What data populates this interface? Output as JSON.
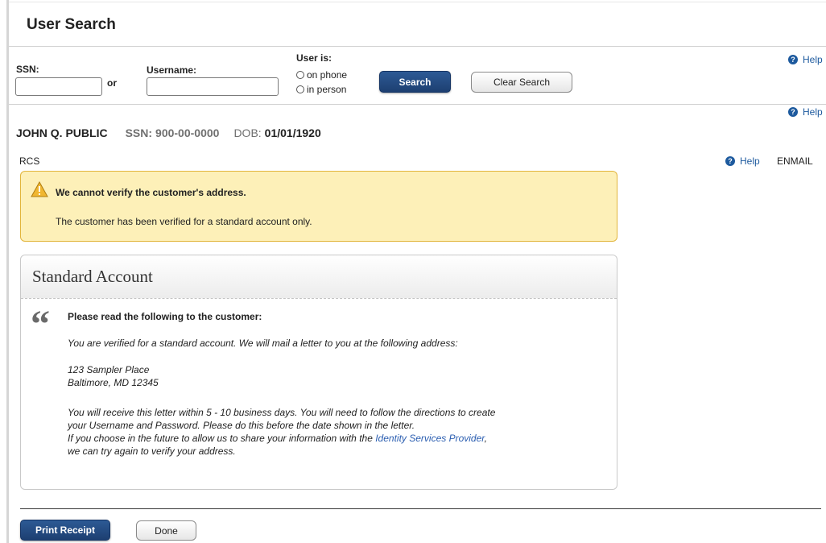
{
  "header": {
    "title": "User Search"
  },
  "search": {
    "ssn_label": "SSN:",
    "ssn_value": "",
    "or_label": "or",
    "username_label": "Username:",
    "username_value": "",
    "user_is_label": "User is:",
    "options": [
      {
        "label": "on phone",
        "selected": false
      },
      {
        "label": "in person",
        "selected": false
      }
    ],
    "search_button": "Search",
    "clear_button": "Clear Search",
    "help_label": "Help"
  },
  "secondary_help_label": "Help",
  "customer": {
    "name": "JOHN Q. PUBLIC",
    "ssn_key": "SSN:",
    "ssn_value": "900-00-0000",
    "dob_key": "DOB:",
    "dob_value": "01/01/1920"
  },
  "context": {
    "left_tag": "RCS",
    "help_label": "Help",
    "right_tag": "ENMAIL"
  },
  "warning": {
    "title": "We cannot verify the customer's address.",
    "text": "The customer has been verified for a standard account only."
  },
  "panel": {
    "title": "Standard Account",
    "prompt": "Please read the following to the customer:",
    "line1": "You are verified for a standard account. We will mail a letter to you at the following address:",
    "address_line1": "123 Sampler Place",
    "address_line2": "Baltimore, MD 12345",
    "para_line1": "You will receive this letter within 5 - 10 business days. You will need to follow the directions to create",
    "para_line2": "your Username and Password. Please do this before the date shown in the letter.",
    "para_line3_prefix": "If you choose in the future to allow us to share your information with the ",
    "para_line3_link": "Identity Services Provider",
    "para_line3_suffix": ",",
    "para_line4": "we can try again to verify your address."
  },
  "footer": {
    "print_button": "Print Receipt",
    "done_button": "Done"
  },
  "colors": {
    "primary_button": "#1d3f71",
    "help_blue": "#1d5a9e",
    "warning_bg": "#fdf0b8",
    "warning_border": "#e2b53c",
    "link": "#2a5db0"
  }
}
